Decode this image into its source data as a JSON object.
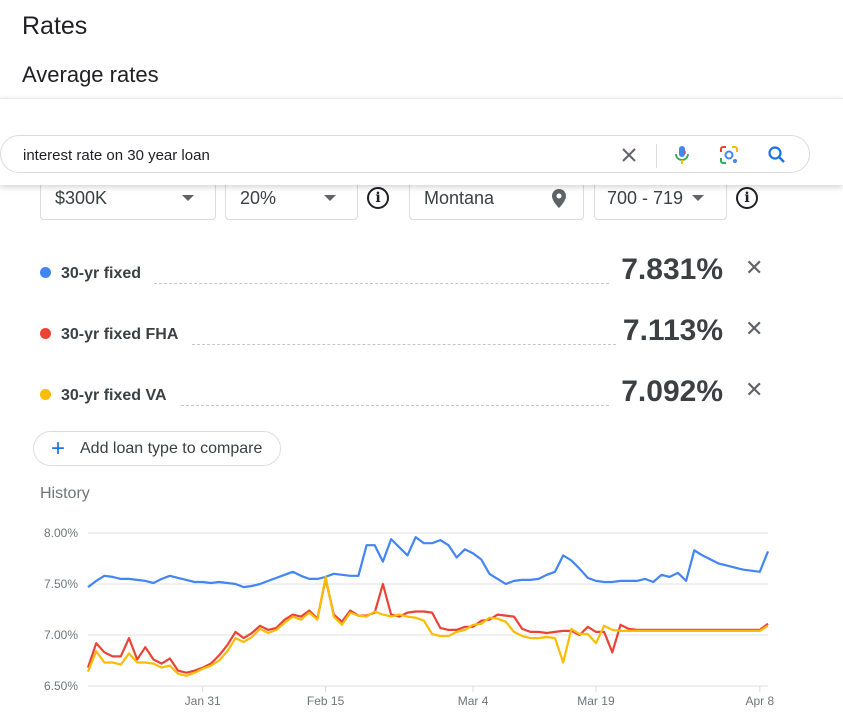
{
  "page": {
    "title": "Rates",
    "subtitle": "Average rates"
  },
  "search": {
    "query": "interest rate on 30 year loan"
  },
  "filters": {
    "loan_amount": "$300K",
    "down_payment": "20%",
    "location": "Montana",
    "credit_score": "700 - 719"
  },
  "rates": [
    {
      "name": "30-yr fixed",
      "value": "7.831%",
      "color": "#4285f4"
    },
    {
      "name": "30-yr fixed FHA",
      "value": "7.113%",
      "color": "#ea4335"
    },
    {
      "name": "30-yr fixed VA",
      "value": "7.092%",
      "color": "#fbbc04"
    }
  ],
  "add_loan_label": "Add loan type to compare",
  "history_label": "History",
  "chart_data": {
    "type": "line",
    "x": [
      "Jan 17",
      "Jan 18",
      "Jan 19",
      "Jan 20",
      "Jan 21",
      "Jan 22",
      "Jan 23",
      "Jan 24",
      "Jan 25",
      "Jan 26",
      "Jan 27",
      "Jan 28",
      "Jan 29",
      "Jan 30",
      "Jan 31",
      "Feb 1",
      "Feb 2",
      "Feb 3",
      "Feb 4",
      "Feb 5",
      "Feb 6",
      "Feb 7",
      "Feb 8",
      "Feb 9",
      "Feb 10",
      "Feb 11",
      "Feb 12",
      "Feb 13",
      "Feb 14",
      "Feb 15",
      "Feb 16",
      "Feb 17",
      "Feb 18",
      "Feb 19",
      "Feb 20",
      "Feb 21",
      "Feb 22",
      "Feb 23",
      "Feb 24",
      "Feb 25",
      "Feb 26",
      "Feb 27",
      "Feb 28",
      "Feb 29",
      "Mar 1",
      "Mar 2",
      "Mar 3",
      "Mar 4",
      "Mar 5",
      "Mar 6",
      "Mar 7",
      "Mar 8",
      "Mar 9",
      "Mar 10",
      "Mar 11",
      "Mar 12",
      "Mar 13",
      "Mar 14",
      "Mar 15",
      "Mar 16",
      "Mar 17",
      "Mar 18",
      "Mar 19",
      "Mar 20",
      "Mar 21",
      "Mar 22",
      "Mar 23",
      "Mar 24",
      "Mar 25",
      "Mar 26",
      "Mar 27",
      "Mar 28",
      "Mar 29",
      "Mar 30",
      "Mar 31",
      "Apr 1",
      "Apr 2",
      "Apr 3",
      "Apr 4",
      "Apr 5",
      "Apr 6",
      "Apr 7",
      "Apr 8",
      "Apr 9"
    ],
    "x_ticks": [
      "Jan 31",
      "Feb 15",
      "Mar 4",
      "Mar 19",
      "Apr 8"
    ],
    "y_ticks": [
      "8.00%",
      "7.50%",
      "7.00%",
      "6.50%"
    ],
    "ylim": [
      6.5,
      8.0
    ],
    "series": [
      {
        "name": "30-yr fixed",
        "color": "#4285f4",
        "values": [
          7.47,
          7.53,
          7.58,
          7.57,
          7.55,
          7.55,
          7.54,
          7.53,
          7.51,
          7.55,
          7.58,
          7.56,
          7.54,
          7.52,
          7.52,
          7.51,
          7.52,
          7.51,
          7.5,
          7.47,
          7.48,
          7.5,
          7.53,
          7.56,
          7.59,
          7.62,
          7.58,
          7.55,
          7.55,
          7.57,
          7.6,
          7.59,
          7.58,
          7.58,
          7.88,
          7.88,
          7.72,
          7.94,
          7.86,
          7.78,
          7.96,
          7.9,
          7.9,
          7.93,
          7.88,
          7.76,
          7.84,
          7.8,
          7.74,
          7.6,
          7.55,
          7.5,
          7.53,
          7.54,
          7.54,
          7.55,
          7.59,
          7.62,
          7.78,
          7.73,
          7.65,
          7.56,
          7.53,
          7.52,
          7.52,
          7.53,
          7.53,
          7.53,
          7.55,
          7.52,
          7.59,
          7.57,
          7.61,
          7.53,
          7.83,
          7.78,
          7.74,
          7.7,
          7.68,
          7.66,
          7.64,
          7.63,
          7.62,
          7.82
        ]
      },
      {
        "name": "30-yr fixed FHA",
        "color": "#ea4335",
        "values": [
          6.68,
          6.92,
          6.83,
          6.79,
          6.79,
          6.97,
          6.76,
          6.88,
          6.76,
          6.72,
          6.77,
          6.65,
          6.63,
          6.65,
          6.68,
          6.72,
          6.8,
          6.9,
          7.03,
          6.97,
          7.02,
          7.09,
          7.05,
          7.07,
          7.15,
          7.2,
          7.18,
          7.24,
          7.16,
          7.55,
          7.2,
          7.13,
          7.24,
          7.19,
          7.19,
          7.22,
          7.5,
          7.2,
          7.18,
          7.22,
          7.23,
          7.23,
          7.22,
          7.07,
          7.05,
          7.05,
          7.08,
          7.08,
          7.14,
          7.15,
          7.2,
          7.19,
          7.18,
          7.06,
          7.03,
          7.03,
          7.02,
          7.03,
          7.04,
          7.04,
          7.0,
          7.08,
          7.03,
          7.03,
          6.83,
          7.1,
          7.06,
          7.05,
          7.05,
          7.05,
          7.05,
          7.05,
          7.05,
          7.05,
          7.05,
          7.05,
          7.05,
          7.05,
          7.05,
          7.05,
          7.05,
          7.05,
          7.05,
          7.11
        ]
      },
      {
        "name": "30-yr fixed VA",
        "color": "#fbbc04",
        "values": [
          6.64,
          6.84,
          6.73,
          6.73,
          6.71,
          6.82,
          6.73,
          6.73,
          6.72,
          6.68,
          6.7,
          6.62,
          6.6,
          6.63,
          6.67,
          6.7,
          6.75,
          6.84,
          6.97,
          6.93,
          6.98,
          7.06,
          7.02,
          7.05,
          7.12,
          7.18,
          7.15,
          7.22,
          7.15,
          7.57,
          7.18,
          7.1,
          7.22,
          7.19,
          7.18,
          7.23,
          7.2,
          7.18,
          7.2,
          7.18,
          7.17,
          7.14,
          7.01,
          6.99,
          6.99,
          7.03,
          7.05,
          7.1,
          7.11,
          7.17,
          7.16,
          7.13,
          7.03,
          6.99,
          6.97,
          6.97,
          6.98,
          6.97,
          6.73,
          7.06,
          7.01,
          7.01,
          6.92,
          7.09,
          7.05,
          7.04,
          7.04,
          7.04,
          7.04,
          7.04,
          7.04,
          7.04,
          7.04,
          7.04,
          7.04,
          7.04,
          7.04,
          7.04,
          7.04,
          7.04,
          7.04,
          7.04,
          7.04,
          7.09
        ]
      }
    ]
  }
}
